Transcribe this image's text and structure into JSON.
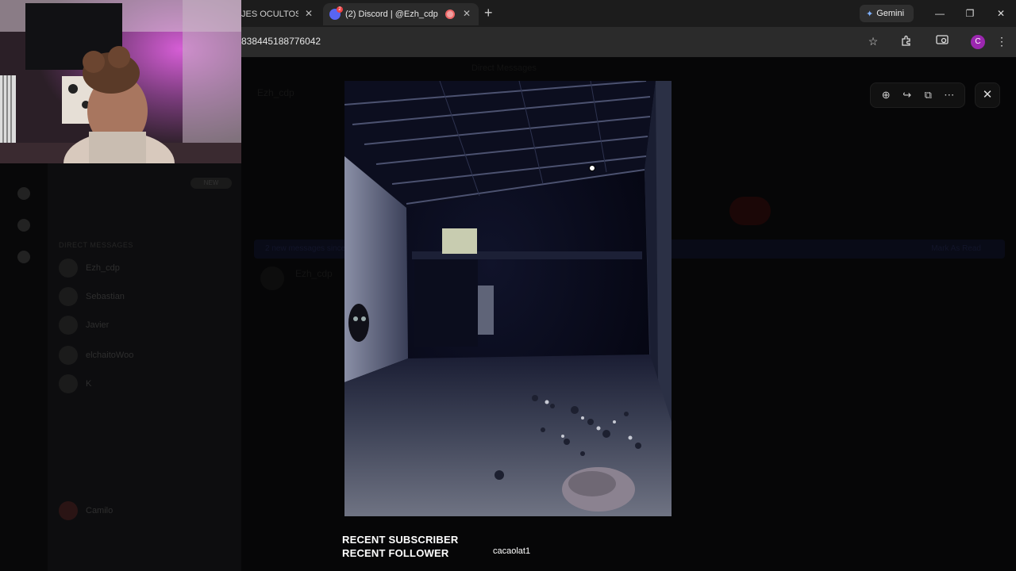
{
  "browser": {
    "tabs": [
      {
        "title": "JES OCULTOS d",
        "active": false
      },
      {
        "title": "(2) Discord | @Ezh_cdp",
        "active": true
      }
    ],
    "favicon_badge": "2",
    "gemini_label": "Gemini",
    "url": "838445188776042",
    "profile_initial": "C",
    "icons": {
      "new_tab": "+",
      "close_tab": "✕",
      "minimize": "—",
      "restore": "❐",
      "close_window": "✕",
      "bookmark": "☆",
      "extensions": "extensions-icon",
      "cast": "cast-icon",
      "menu": "⋮"
    }
  },
  "discord": {
    "top_title": "Direct Messages",
    "chat_title": "Ezh_cdp",
    "banner_left": "2 new messages since",
    "banner_right": "Mark As Read",
    "message_author": "Ezh_cdp",
    "dm_header": "DIRECT MESSAGES",
    "nitro_badge": "NEW",
    "dm_list": [
      {
        "name": "Ezh_cdp"
      },
      {
        "name": "Sebastian"
      },
      {
        "name": "Javier"
      },
      {
        "name": "elchaitoWoo"
      },
      {
        "name": "K"
      }
    ],
    "user_name": "Camilo"
  },
  "lightbox": {
    "tools": [
      "zoom-in-icon",
      "forward-icon",
      "open-in-new-icon",
      "more-icon"
    ],
    "tool_glyphs": [
      "⊕",
      "↪",
      "⧉",
      "⋯"
    ],
    "close_glyph": "✕"
  },
  "stream_overlay": {
    "recent_subscriber_label": "RECENT SUBSCRIBER",
    "recent_follower_label": "RECENT FOLLOWER",
    "recent_follower_value": "cacaolat1"
  }
}
